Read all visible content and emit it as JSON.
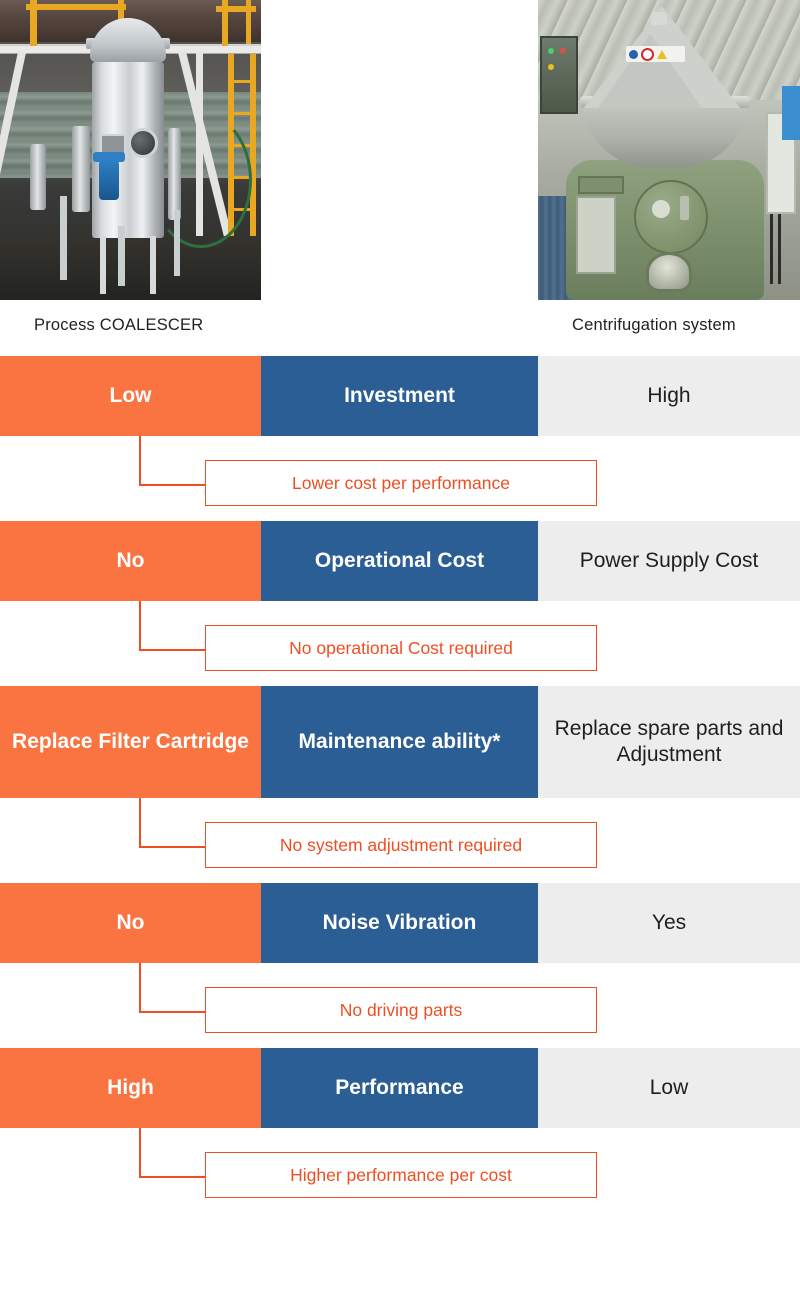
{
  "header": {
    "photos": [
      {
        "caption": "Process COALESCER",
        "alt_name": "coalescer-vessel-photo"
      },
      {
        "caption": "Centrifugation system",
        "alt_name": "centrifuge-separator-photo"
      }
    ]
  },
  "colors": {
    "left_column": "#fa7441",
    "middle_column": "#2a5e95",
    "right_column": "#ededed",
    "note_accent": "#ee4f22",
    "background": "#ffffff",
    "dark_text": "#1f1f1f",
    "light_text": "#ffffff"
  },
  "comparison": {
    "rows": [
      {
        "left": "Low",
        "criterion": "Investment",
        "right": "High",
        "note": "Lower cost per performance",
        "tall": false
      },
      {
        "left": "No",
        "criterion": "Operational Cost",
        "right": "Power Supply Cost",
        "note": "No operational Cost required",
        "tall": false
      },
      {
        "left": "Replace Filter Cartridge",
        "criterion": "Maintenance ability*",
        "right": "Replace spare parts and Adjustment",
        "note": "No system adjustment required",
        "tall": true
      },
      {
        "left": "No",
        "criterion": "Noise Vibration",
        "right": "Yes",
        "note": "No driving parts",
        "tall": false
      },
      {
        "left": "High",
        "criterion": "Performance",
        "right": "Low",
        "note": "Higher performance per cost",
        "tall": false
      }
    ]
  }
}
